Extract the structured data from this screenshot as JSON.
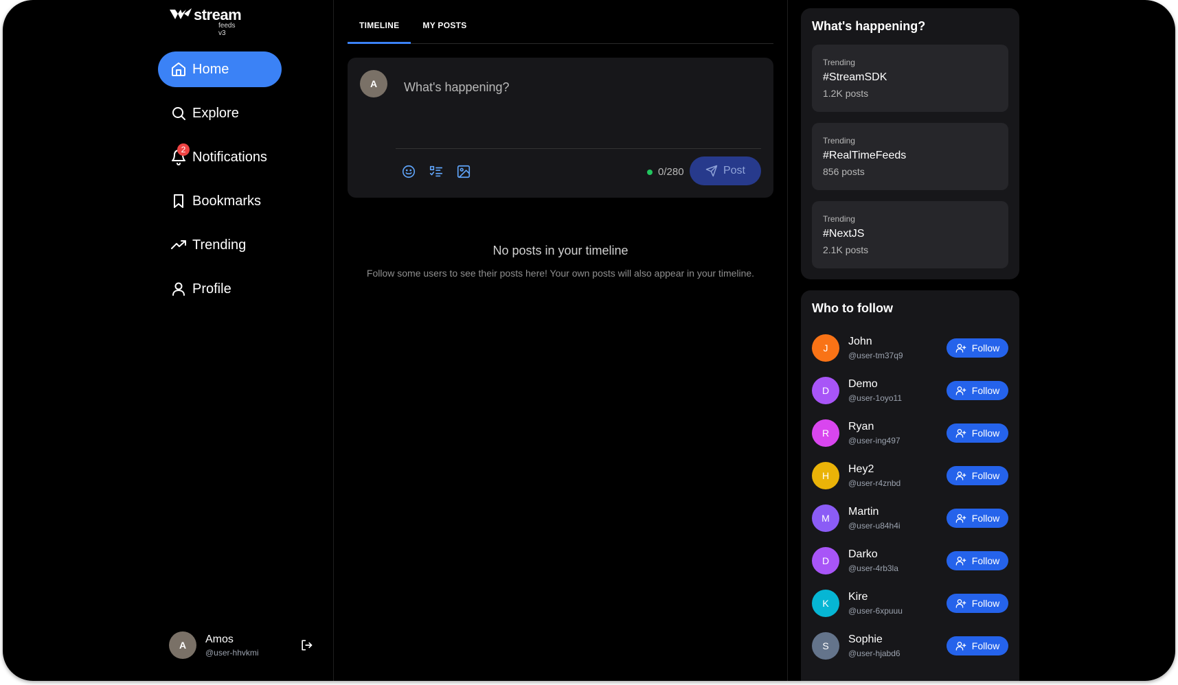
{
  "brand": {
    "name": "stream",
    "sub": "feeds v3"
  },
  "nav": [
    {
      "label": "Home",
      "icon": "home-icon",
      "active": true
    },
    {
      "label": "Explore",
      "icon": "search-icon"
    },
    {
      "label": "Notifications",
      "icon": "bell-icon",
      "badge": "2"
    },
    {
      "label": "Bookmarks",
      "icon": "bookmark-icon"
    },
    {
      "label": "Trending",
      "icon": "trending-icon"
    },
    {
      "label": "Profile",
      "icon": "user-icon"
    }
  ],
  "current_user": {
    "initial": "A",
    "name": "Amos",
    "handle": "@user-hhvkmi"
  },
  "tabs": [
    {
      "label": "TIMELINE",
      "active": true
    },
    {
      "label": "MY POSTS"
    }
  ],
  "composer": {
    "avatar_initial": "A",
    "placeholder": "What's happening?",
    "counter": "0/280",
    "post_label": "Post"
  },
  "empty_state": {
    "title": "No posts in your timeline",
    "message": "Follow some users to see their posts here! Your own posts will also appear in your timeline."
  },
  "trends": {
    "title": "What's happening?",
    "items": [
      {
        "label": "Trending",
        "tag": "#StreamSDK",
        "count": "1.2K posts"
      },
      {
        "label": "Trending",
        "tag": "#RealTimeFeeds",
        "count": "856 posts"
      },
      {
        "label": "Trending",
        "tag": "#NextJS",
        "count": "2.1K posts"
      }
    ]
  },
  "who_to_follow": {
    "title": "Who to follow",
    "button_label": "Follow",
    "users": [
      {
        "initial": "J",
        "name": "John",
        "handle": "@user-tm37q9",
        "color": "#f97316"
      },
      {
        "initial": "D",
        "name": "Demo",
        "handle": "@user-1oyo11",
        "color": "#a855f7"
      },
      {
        "initial": "R",
        "name": "Ryan",
        "handle": "@user-ing497",
        "color": "#d946ef"
      },
      {
        "initial": "H",
        "name": "Hey2",
        "handle": "@user-r4znbd",
        "color": "#eab308"
      },
      {
        "initial": "M",
        "name": "Martin",
        "handle": "@user-u84h4i",
        "color": "#8b5cf6"
      },
      {
        "initial": "D",
        "name": "Darko",
        "handle": "@user-4rb3la",
        "color": "#a855f7"
      },
      {
        "initial": "K",
        "name": "Kire",
        "handle": "@user-6xpuuu",
        "color": "#06b6d4"
      },
      {
        "initial": "S",
        "name": "Sophie",
        "handle": "@user-hjabd6",
        "color": "#64748b"
      }
    ]
  },
  "colors": {
    "accent": "#3b82f6",
    "follow": "#2563eb",
    "badge": "#ef4444",
    "online": "#22c55e"
  }
}
